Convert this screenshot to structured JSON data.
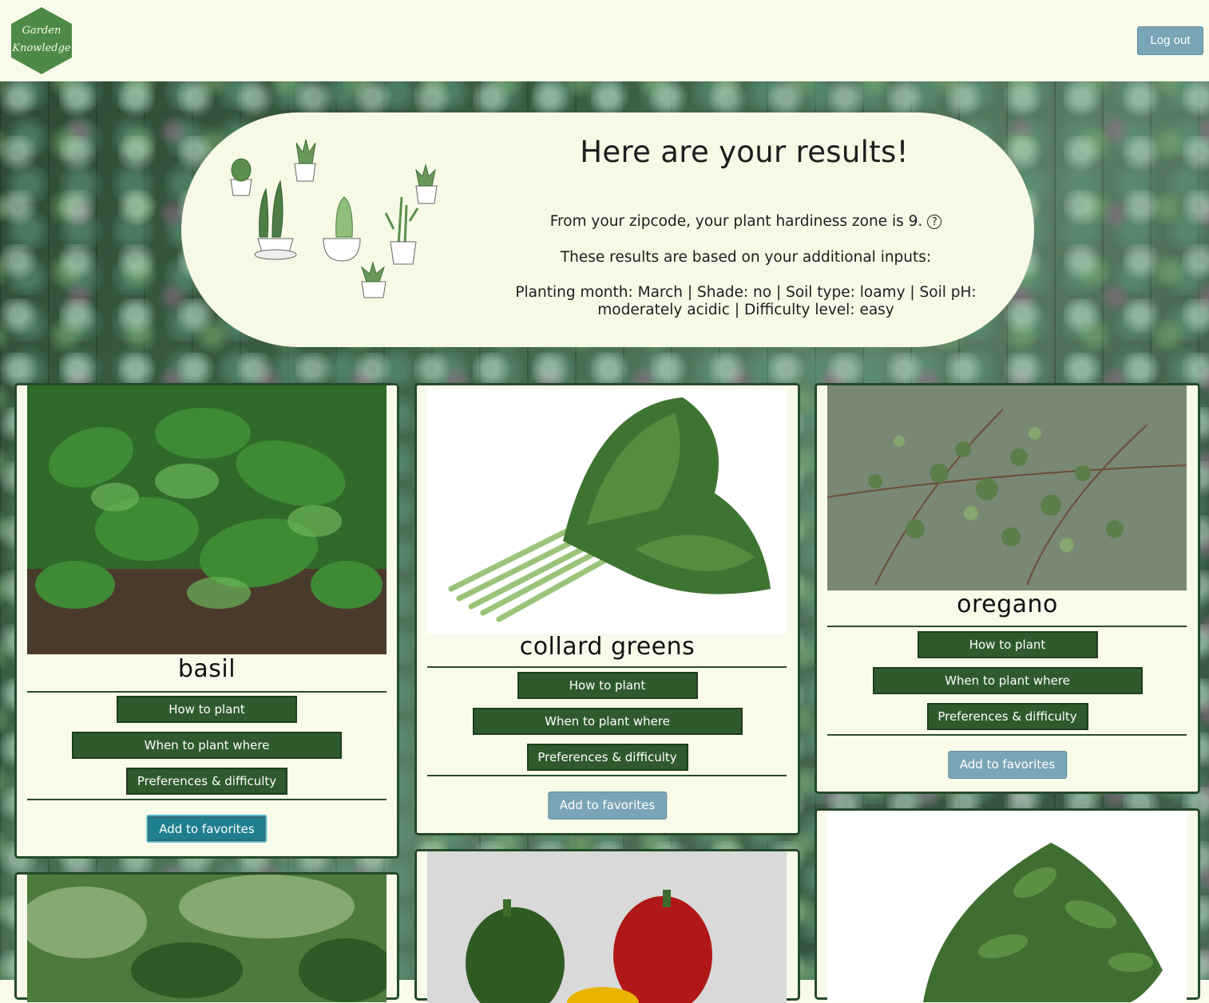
{
  "header": {
    "logo_text": "Garden\nKnowledge",
    "logout_label": "Log out"
  },
  "results": {
    "title": "Here are your results!",
    "zone_text": "From your zipcode, your plant hardiness zone is 9.",
    "help_glyph": "?",
    "inputs_intro": "These results are based on your additional inputs:",
    "inputs_summary": "Planting month: March | Shade: no | Soil type: loamy | Soil pH: moderately acidic | Difficulty level: easy"
  },
  "plants": [
    {
      "name": "basil",
      "btn_how": "How to plant",
      "btn_when": "When to plant where",
      "btn_pref": "Preferences & difficulty",
      "fav": "Add to favorites"
    },
    {
      "name": "collard greens",
      "btn_how": "How to plant",
      "btn_when": "When to plant where",
      "btn_pref": "Preferences & difficulty",
      "fav": "Add to favorites"
    },
    {
      "name": "oregano",
      "btn_how": "How to plant",
      "btn_when": "When to plant where",
      "btn_pref": "Preferences & difficulty",
      "fav": "Add to favorites"
    }
  ],
  "colors": {
    "page_bg": "#f8fbea",
    "button_green": "#2e5a2d",
    "button_blue": "#7aa5b6",
    "card_border": "#264a2b"
  }
}
